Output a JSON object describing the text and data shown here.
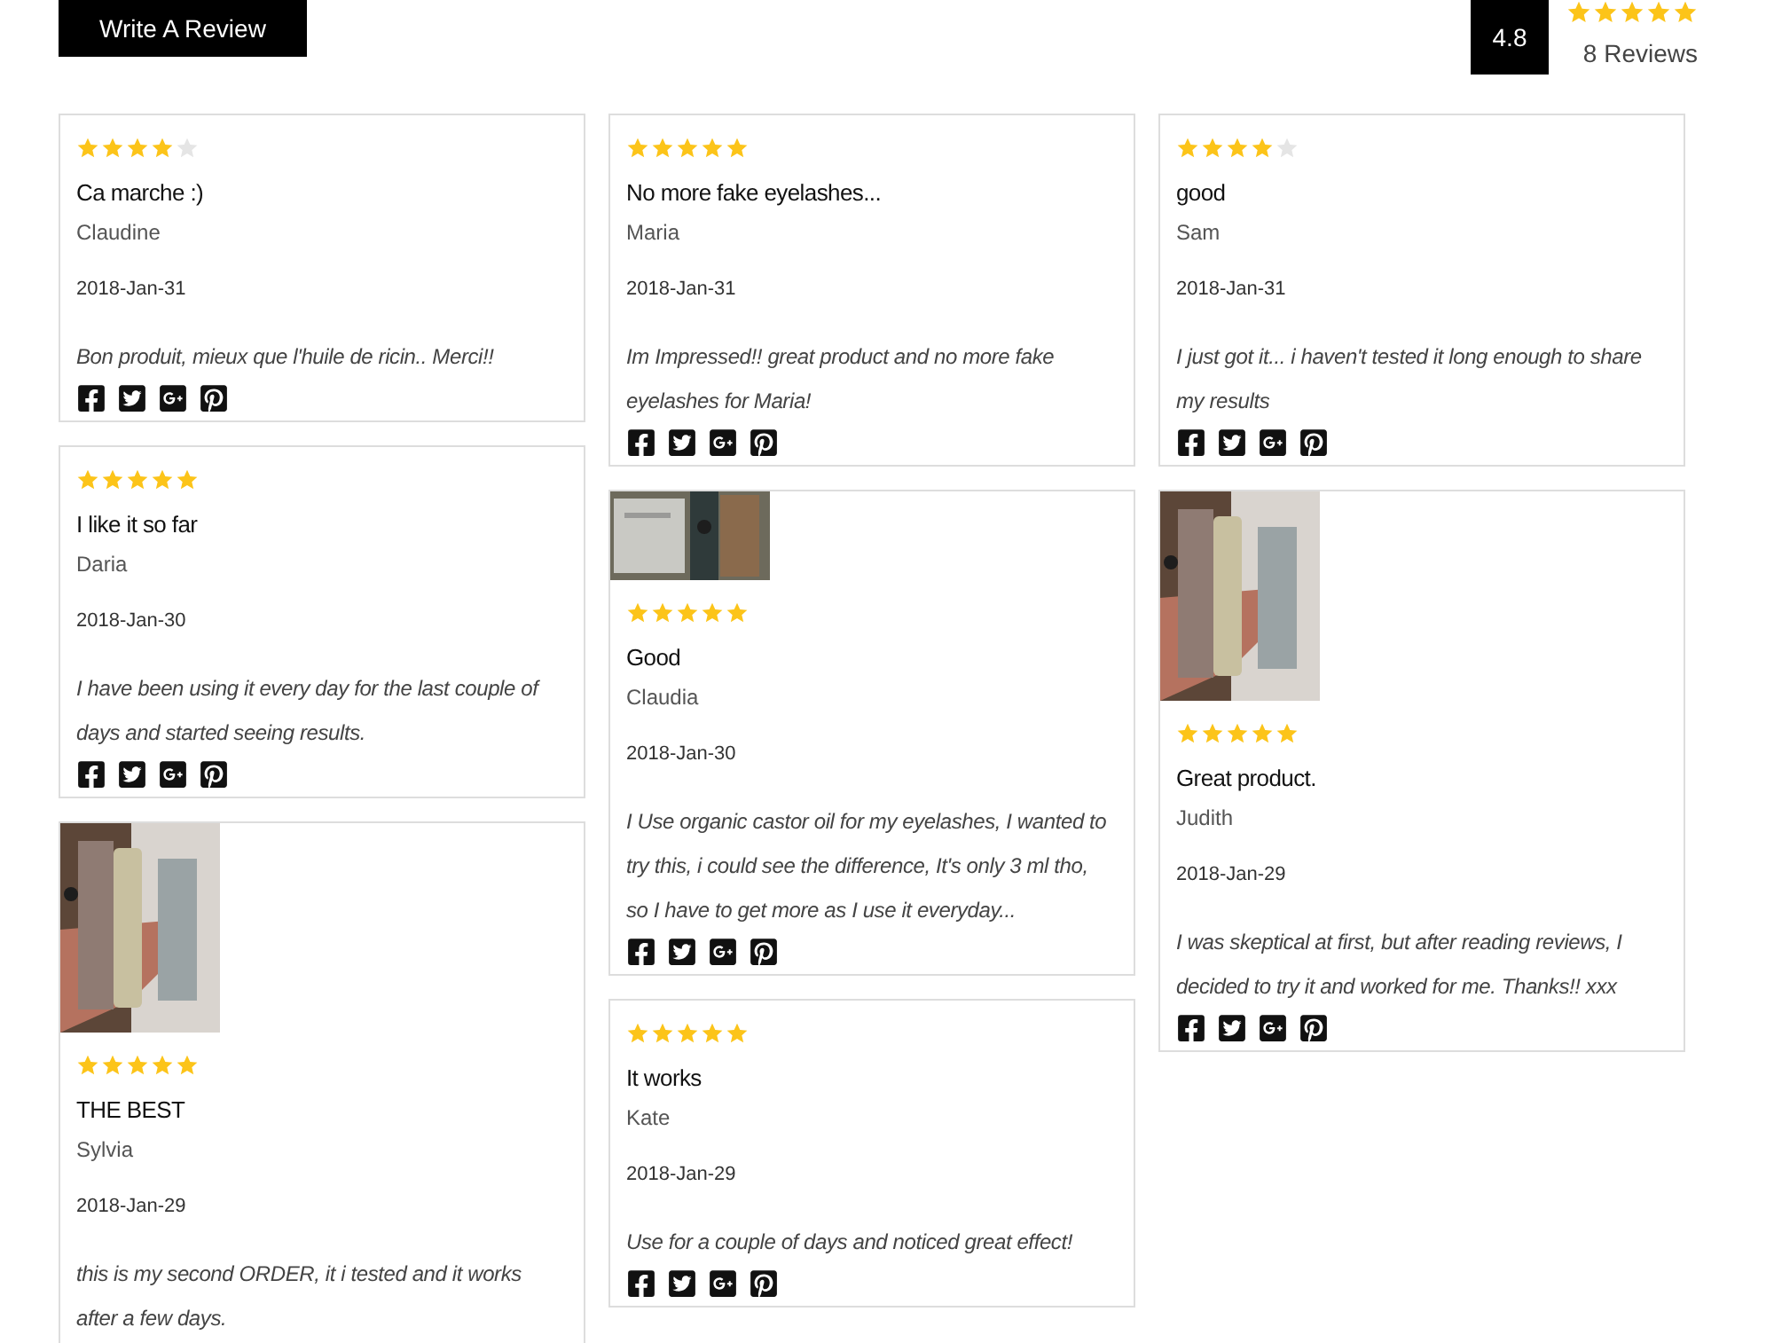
{
  "header": {
    "write_button": "Write A Review",
    "rating": "4.8",
    "stars": 5,
    "review_count": "8 Reviews"
  },
  "columns": [
    [
      {
        "stars": 4,
        "title": "Ca marche :)",
        "author": "Claudine",
        "date": "2018-Jan-31",
        "body": "Bon produit, mieux que l'huile de ricin.. Merci!!"
      },
      {
        "stars": 5,
        "title": "I like it so far",
        "author": "Daria",
        "date": "2018-Jan-30",
        "body": "I have been using it every day for the last couple of days and started seeing results."
      },
      {
        "stars": 5,
        "title": "THE BEST",
        "author": "Sylvia",
        "date": "2018-Jan-29",
        "body": "this is my second ORDER, it i tested and it works after a few days."
      }
    ],
    [
      {
        "stars": 5,
        "title": "No more fake eyelashes...",
        "author": "Maria",
        "date": "2018-Jan-31",
        "body": "Im Impressed!! great product and no more fake eyelashes for Maria!"
      },
      {
        "stars": 5,
        "title": "Good",
        "author": "Claudia",
        "date": "2018-Jan-30",
        "body": "I Use organic castor oil for my eyelashes, I wanted to try this, i could see the difference, It's only 3 ml tho, so I have to get more as I use it everyday..."
      },
      {
        "stars": 5,
        "title": "It works",
        "author": "Kate",
        "date": "2018-Jan-29",
        "body": "Use for a couple of days and noticed great effect!"
      }
    ],
    [
      {
        "stars": 4,
        "title": "good",
        "author": "Sam",
        "date": "2018-Jan-31",
        "body": "I just got it... i haven't tested it long enough to share my results"
      },
      {
        "stars": 5,
        "title": "Great product.",
        "author": "Judith",
        "date": "2018-Jan-29",
        "body": "I was skeptical at first, but after reading reviews, I decided to try it and worked for me. Thanks!! xxx"
      }
    ]
  ]
}
